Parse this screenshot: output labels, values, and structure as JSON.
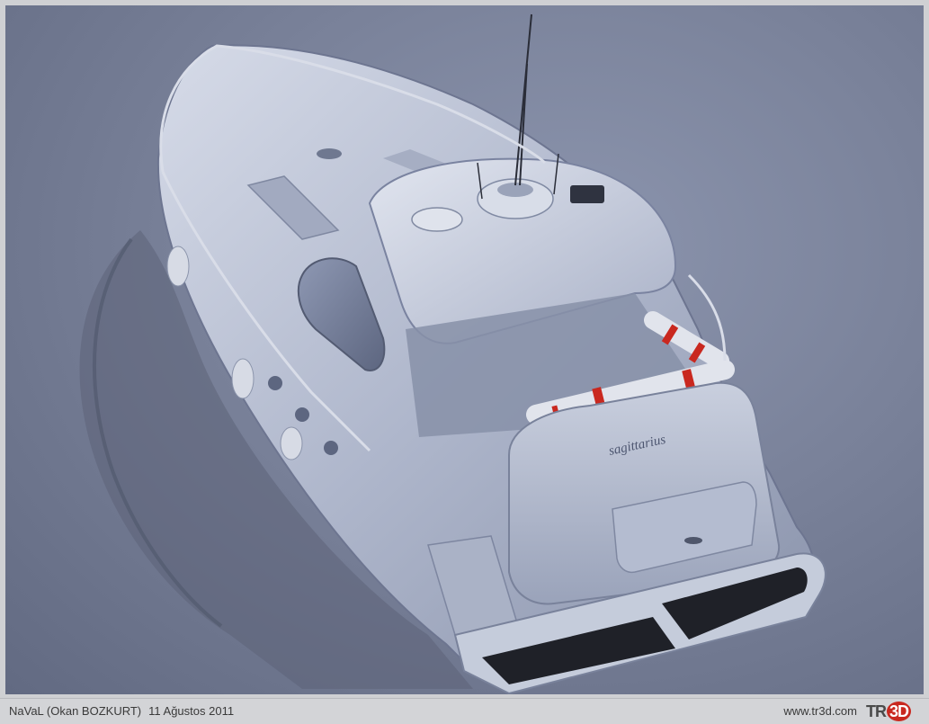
{
  "image": {
    "boat_name": "sagittarius"
  },
  "caption": {
    "author": "NaVaL (Okan BOZKURT)",
    "date": "11 Ağustos 2011",
    "site_url": "www.tr3d.com",
    "logo_text_left": "TR",
    "logo_text_right": "3D"
  },
  "colors": {
    "background": "#7a829a",
    "hull": "#b9c0d3",
    "accent_red": "#c9281f",
    "caption_bar": "#d3d4d7"
  }
}
